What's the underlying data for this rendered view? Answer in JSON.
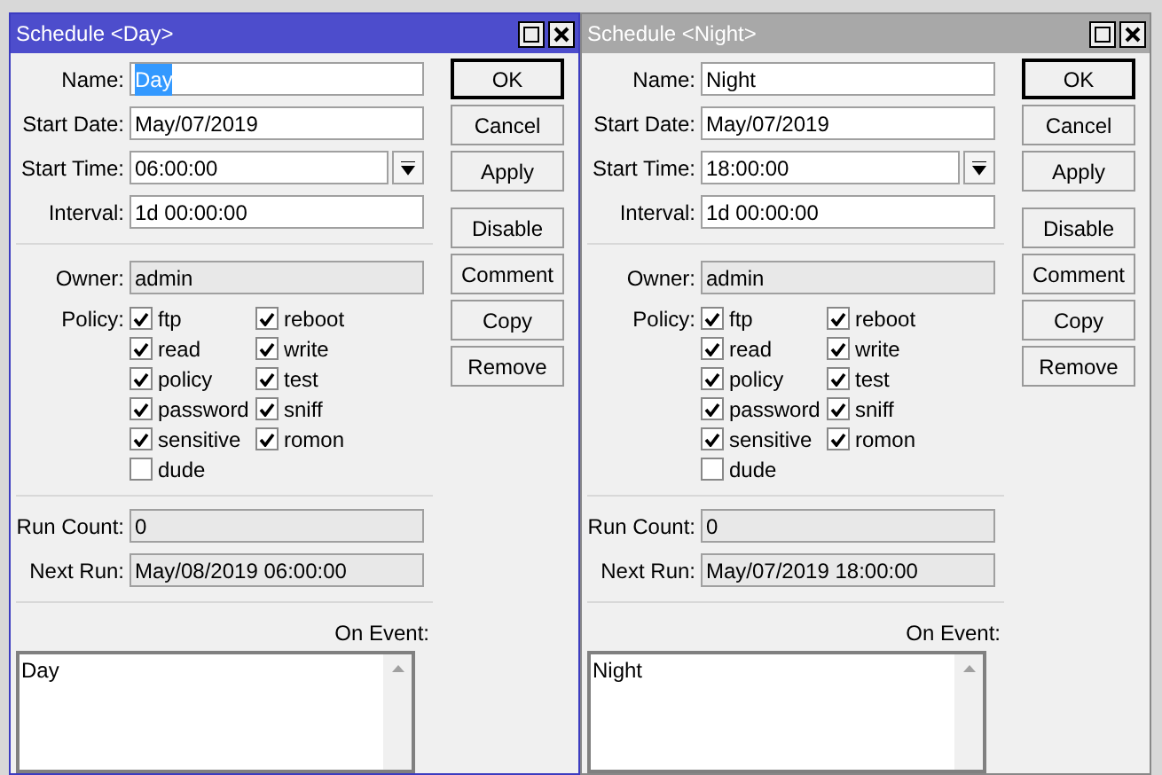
{
  "windows": [
    {
      "title": "Schedule <Day>",
      "active": true,
      "fields": [
        {
          "label": "Name:",
          "value": "Day",
          "kind": "text",
          "selected": true
        },
        {
          "label": "Start Date:",
          "value": "May/07/2019",
          "kind": "text",
          "selected": false
        },
        {
          "label": "Start Time:",
          "value": "06:00:00",
          "kind": "time",
          "selected": false
        },
        {
          "label": "Interval:",
          "value": "1d 00:00:00",
          "kind": "text",
          "selected": false
        }
      ],
      "owner": {
        "label": "Owner:",
        "value": "admin"
      },
      "policy_label": "Policy:",
      "policy": [
        {
          "label": "ftp",
          "checked": true
        },
        {
          "label": "reboot",
          "checked": true
        },
        {
          "label": "read",
          "checked": true
        },
        {
          "label": "write",
          "checked": true
        },
        {
          "label": "policy",
          "checked": true
        },
        {
          "label": "test",
          "checked": true
        },
        {
          "label": "password",
          "checked": true
        },
        {
          "label": "sniff",
          "checked": true
        },
        {
          "label": "sensitive",
          "checked": true
        },
        {
          "label": "romon",
          "checked": true
        },
        {
          "label": "dude",
          "checked": false
        }
      ],
      "status": [
        {
          "label": "Run Count:",
          "value": "0"
        },
        {
          "label": "Next Run:",
          "value": "May/08/2019 06:00:00"
        }
      ],
      "on_event_label": "On Event:",
      "on_event": "Day",
      "buttons": [
        "OK",
        "Cancel",
        "Apply",
        "Disable",
        "Comment",
        "Copy",
        "Remove"
      ]
    },
    {
      "title": "Schedule <Night>",
      "active": false,
      "fields": [
        {
          "label": "Name:",
          "value": "Night",
          "kind": "text",
          "selected": false
        },
        {
          "label": "Start Date:",
          "value": "May/07/2019",
          "kind": "text",
          "selected": false
        },
        {
          "label": "Start Time:",
          "value": "18:00:00",
          "kind": "time",
          "selected": false
        },
        {
          "label": "Interval:",
          "value": "1d 00:00:00",
          "kind": "text",
          "selected": false
        }
      ],
      "owner": {
        "label": "Owner:",
        "value": "admin"
      },
      "policy_label": "Policy:",
      "policy": [
        {
          "label": "ftp",
          "checked": true
        },
        {
          "label": "reboot",
          "checked": true
        },
        {
          "label": "read",
          "checked": true
        },
        {
          "label": "write",
          "checked": true
        },
        {
          "label": "policy",
          "checked": true
        },
        {
          "label": "test",
          "checked": true
        },
        {
          "label": "password",
          "checked": true
        },
        {
          "label": "sniff",
          "checked": true
        },
        {
          "label": "sensitive",
          "checked": true
        },
        {
          "label": "romon",
          "checked": true
        },
        {
          "label": "dude",
          "checked": false
        }
      ],
      "status": [
        {
          "label": "Run Count:",
          "value": "0"
        },
        {
          "label": "Next Run:",
          "value": "May/07/2019 18:00:00"
        }
      ],
      "on_event_label": "On Event:",
      "on_event": "Night",
      "buttons": [
        "OK",
        "Cancel",
        "Apply",
        "Disable",
        "Comment",
        "Copy",
        "Remove"
      ]
    }
  ]
}
